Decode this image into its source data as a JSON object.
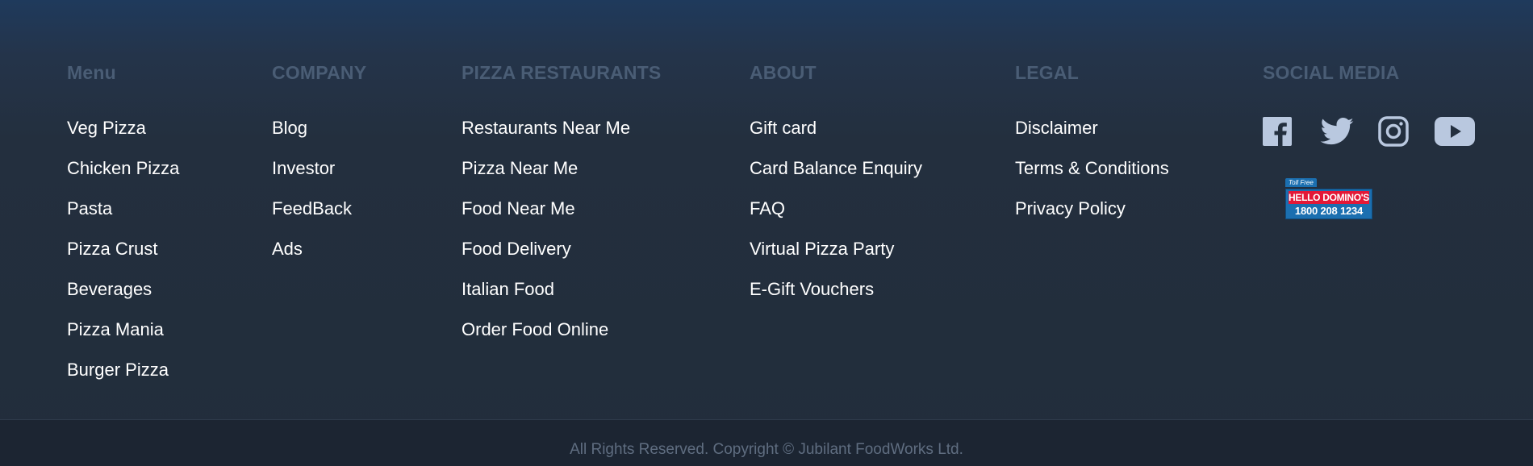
{
  "columns": [
    {
      "heading": "Menu",
      "links": [
        "Veg Pizza",
        "Chicken Pizza",
        "Pasta",
        "Pizza Crust",
        "Beverages",
        "Pizza Mania",
        "Burger Pizza"
      ]
    },
    {
      "heading": "COMPANY",
      "links": [
        "Blog",
        "Investor",
        "FeedBack",
        "Ads"
      ]
    },
    {
      "heading": "PIZZA RESTAURANTS",
      "links": [
        "Restaurants Near Me",
        "Pizza Near Me",
        "Food Near Me",
        "Food Delivery",
        "Italian Food",
        "Order Food Online"
      ]
    },
    {
      "heading": "ABOUT",
      "links": [
        "Gift card",
        "Card Balance Enquiry",
        "FAQ",
        "Virtual Pizza Party",
        "E-Gift Vouchers"
      ]
    },
    {
      "heading": "LEGAL",
      "links": [
        "Disclaimer",
        "Terms & Conditions",
        "Privacy Policy"
      ]
    }
  ],
  "social": {
    "heading": "SOCIAL MEDIA",
    "icons": [
      "facebook-icon",
      "twitter-icon",
      "instagram-icon",
      "youtube-icon"
    ],
    "hotline": {
      "tag": "Toll Free",
      "brand": "HELLO DOMINO'S",
      "number": "1800 208 1234"
    }
  },
  "copyright": "All Rights Reserved. Copyright © Jubilant FoodWorks Ltd.",
  "colors": {
    "heading": "#4a5d75",
    "link": "#ffffff",
    "background": "#232f3e",
    "icon": "#b9c8df"
  }
}
